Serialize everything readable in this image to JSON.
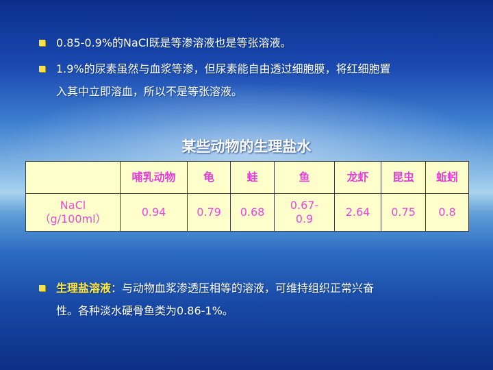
{
  "bullets": [
    {
      "text": "0.85-0.9%的NaCl既是等渗溶液也是等张溶液。"
    },
    {
      "line1": "1.9%的尿素虽然与血浆等渗，但尿素能自由透过细胞膜，将红细胞置",
      "line2": "入其中立即溶血，所以不是等张溶液。"
    },
    {
      "term": "生理盐溶液",
      "line1_rest": "：与动物血浆渗透压相等的溶液，可维持组织正常兴奋",
      "line2": "性。各种淡水硬骨鱼类为0.86-1%。"
    }
  ],
  "table": {
    "title": "某些动物的生理盐水",
    "header": [
      "",
      "哺乳动物",
      "龟",
      "蛙",
      "鱼",
      "龙虾",
      "昆虫",
      "蚯蚓"
    ],
    "row_label": "NaCl（g/100ml）",
    "values": [
      "0.94",
      "0.79",
      "0.68",
      "0.67-0.9",
      "2.64",
      "0.75",
      "0.8"
    ]
  },
  "colors": {
    "bullet": "#f5e24a",
    "highlight": "#ffe840",
    "table_text": "#e23fd6",
    "table_bg": "#ffffcc"
  }
}
